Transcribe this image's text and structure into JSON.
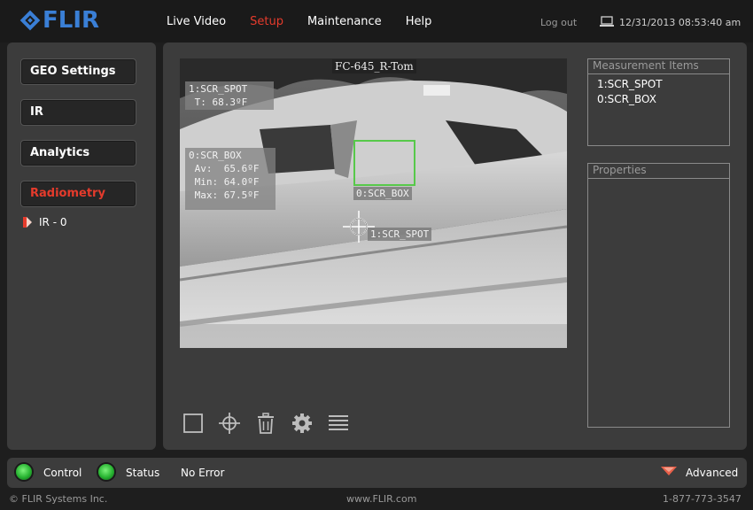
{
  "header": {
    "logo_text": "FLIR",
    "nav": [
      "Live Video",
      "Setup",
      "Maintenance",
      "Help"
    ],
    "active_nav": "Setup",
    "logout": "Log out",
    "datetime": "12/31/2013 08:53:40 am"
  },
  "sidebar": {
    "items": [
      {
        "label": "GEO Settings"
      },
      {
        "label": "IR"
      },
      {
        "label": "Analytics"
      },
      {
        "label": "Radiometry"
      }
    ],
    "active": "Radiometry",
    "sub_item": "IR - 0"
  },
  "video": {
    "camera_title": "FC-645_R-Tom",
    "spot_overlay": {
      "title": "1:SCR_SPOT",
      "temp": " T: 68.3ºF"
    },
    "box_overlay": {
      "title": "0:SCR_BOX",
      "av": " Av:  65.6ºF",
      "min": " Min: 64.0ºF",
      "max": " Max: 67.5ºF"
    },
    "box_label": "0:SCR_BOX",
    "spot_label": "1:SCR_SPOT"
  },
  "toolbar": {
    "icons": [
      "box-tool-icon",
      "spot-tool-icon",
      "trash-icon",
      "gear-icon",
      "list-icon"
    ]
  },
  "measurement_items": {
    "title": "Measurement Items",
    "items": [
      "1:SCR_SPOT",
      "0:SCR_BOX"
    ]
  },
  "properties": {
    "title": "Properties"
  },
  "status": {
    "control": "Control",
    "status": "Status",
    "error": "No Error",
    "advanced": "Advanced",
    "led_color": "#27b331"
  },
  "footer": {
    "copyright": "© FLIR Systems Inc.",
    "website": "www.FLIR.com",
    "phone": "1-877-773-3547"
  },
  "colors": {
    "accent_red": "#e53b2c",
    "brand_blue": "#3a7fd6",
    "measure_green": "#57c94a"
  }
}
